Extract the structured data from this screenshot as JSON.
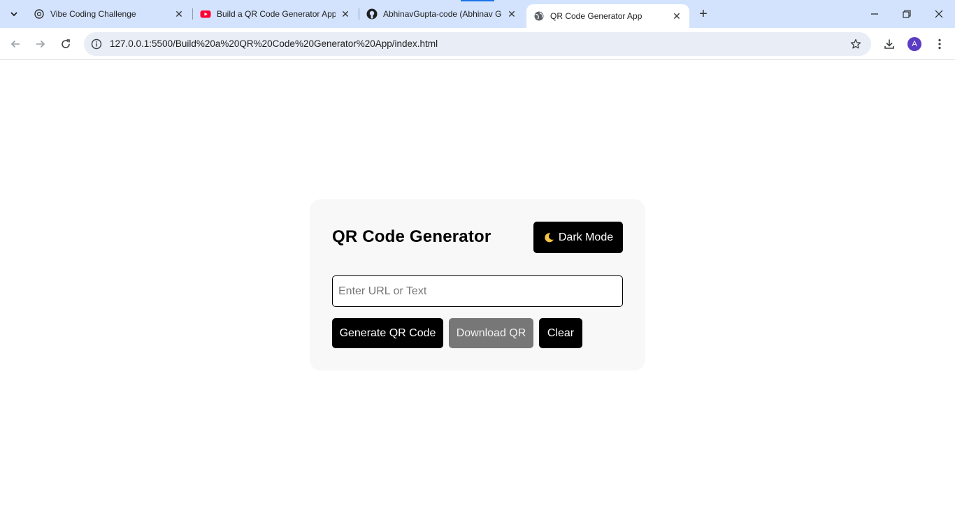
{
  "browser": {
    "tabs": [
      {
        "title": "Vibe Coding Challenge",
        "icon": "openai-icon",
        "active": false
      },
      {
        "title": "Build a QR Code Generator App",
        "icon": "youtube-icon",
        "active": false
      },
      {
        "title": "AbhinavGupta-code (Abhinav G",
        "icon": "github-icon",
        "active": false
      },
      {
        "title": "QR Code Generator App",
        "icon": "globe-icon",
        "active": true
      }
    ],
    "close_glyph": "✕",
    "new_tab_glyph": "+",
    "url": "127.0.0.1:5500/Build%20a%20QR%20Code%20Generator%20App/index.html",
    "profile_initial": "A",
    "colors": {
      "tabstrip": "#d3e3fd",
      "omnibox": "#e9eef6",
      "avatar": "#5b3cc4"
    }
  },
  "app": {
    "title": "QR Code Generator",
    "dark_mode_label": "Dark Mode",
    "input": {
      "value": "",
      "placeholder": "Enter URL or Text"
    },
    "buttons": {
      "generate": "Generate QR Code",
      "download": "Download QR",
      "clear": "Clear"
    },
    "colors": {
      "card": "#f8f8f8",
      "primary_button": "#000000",
      "disabled_button": "#777777"
    }
  }
}
